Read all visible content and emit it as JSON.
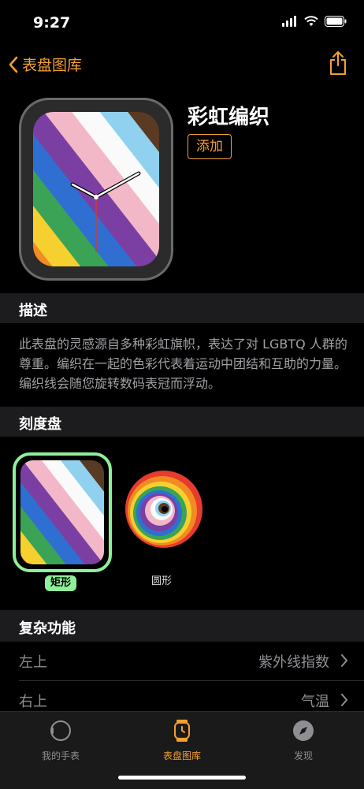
{
  "status": {
    "time": "9:27"
  },
  "nav": {
    "back_label": "表盘图库"
  },
  "face": {
    "title": "彩虹编织",
    "add_label": "添加"
  },
  "sections": {
    "description_title": "描述",
    "description_text": "此表盘的灵感源自多种彩虹旗帜，表达了对 LGBTQ 人群的尊重。编织在一起的色彩代表着运动中团结和互助的力量。编织线会随您旋转数码表冠而浮动。",
    "dial_title": "刻度盘",
    "complications_title": "复杂功能"
  },
  "dials": [
    {
      "label": "矩形",
      "selected": true
    },
    {
      "label": "圆形",
      "selected": false
    }
  ],
  "complications": [
    {
      "position": "左上",
      "value": "紫外线指数"
    },
    {
      "position": "右上",
      "value": "气温"
    }
  ],
  "tabs": [
    {
      "label": "我的手表",
      "icon": "watch-outline-icon"
    },
    {
      "label": "表盘图库",
      "icon": "watch-face-icon",
      "active": true
    },
    {
      "label": "发现",
      "icon": "compass-icon"
    }
  ],
  "colors": {
    "accent": "#f5a030",
    "selected_dial": "#8ef09a",
    "section_bg": "#1c1c1e"
  }
}
